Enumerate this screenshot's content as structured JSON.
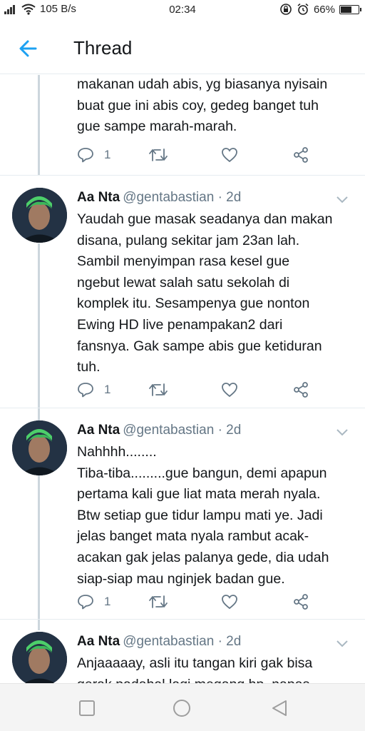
{
  "status_bar": {
    "net_speed": "105 B/s",
    "time": "02:34",
    "battery": "66%",
    "battery_level": 0.66
  },
  "header": {
    "title": "Thread",
    "back_icon": "arrow-left-icon",
    "accent": "#1da1f2"
  },
  "tweets": [
    {
      "name": "",
      "handle": "",
      "text": "makanan udah abis, yg biasanya nyisain\nbuat gue ini abis coy, gedeg banget tuh\ngue sampe marah-marah.",
      "replies": "1"
    },
    {
      "name": "Aa Nta",
      "handle": "@gentabastian · 2d",
      "text": "Yaudah gue masak seadanya dan makan\ndisana, pulang sekitar jam 23an lah.\nSambil menyimpan rasa kesel gue\nngebut lewat salah satu sekolah di\nkomplek itu. Sesampenya gue nonton\nEwing HD live penampakan2 dari\nfansnya. Gak sampe abis gue ketiduran\ntuh.",
      "replies": "1"
    },
    {
      "name": "Aa Nta",
      "handle": "@gentabastian · 2d",
      "text": "Nahhhh........\nTiba-tiba.........gue bangun, demi apapun\npertama kali gue liat mata merah nyala.\nBtw setiap gue tidur lampu mati ye. Jadi\njelas banget mata nyala rambut acak-\nacakan gak jelas palanya gede, dia udah\nsiap-siap mau nginjek badan gue.",
      "replies": "1"
    },
    {
      "name": "Aa Nta",
      "handle": "@gentabastian · 2d",
      "text": "Anjaaaaay, asli itu tangan kiri gak bisa\ngerak padahal lagi megang hp, napas",
      "replies": ""
    }
  ],
  "icons": {
    "reply": "reply-icon",
    "retweet": "retweet-icon",
    "like": "heart-icon",
    "share": "share-icon",
    "caret": "chevron-down-icon"
  },
  "nav": {
    "recents": "square-icon",
    "home": "circle-icon",
    "back": "triangle-back-icon"
  }
}
